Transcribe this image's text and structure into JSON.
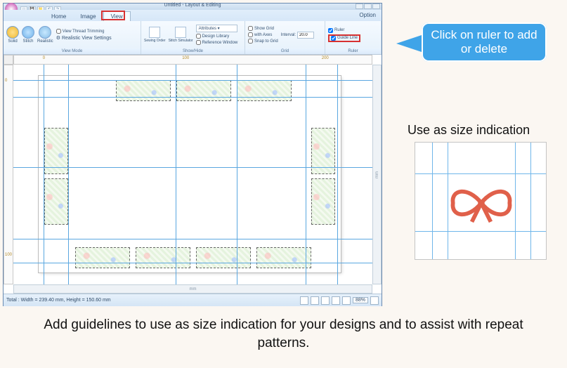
{
  "window": {
    "title": "Untitled - Layout & Editing",
    "option": "Option"
  },
  "tabs": {
    "home": "Home",
    "image": "Image",
    "view": "View"
  },
  "ribbon": {
    "view_mode": {
      "label": "View Mode",
      "solid": "Solid",
      "stitch": "Stitch",
      "realistic": "Realistic",
      "thread_trimming": "View Thread Trimming",
      "realistic_settings": "Realistic View Settings"
    },
    "show_hide": {
      "label": "Show/Hide",
      "sewing_order": "Sewing\nOrder",
      "stitch_simulator": "Stitch\nSimulator",
      "attributes": "Attributes",
      "design_library": "Design Library",
      "reference_window": "Reference Window"
    },
    "grid": {
      "label": "Grid",
      "show_grid": "Show Grid",
      "with_axes": "with Axes",
      "snap": "Snap to Grid",
      "interval_label": "Interval:",
      "interval_value": "20.0"
    },
    "ruler_group": {
      "label": "Ruler",
      "ruler": "Ruler",
      "guide_line": "Guide Line"
    }
  },
  "ruler": {
    "h0": "0",
    "h100": "100",
    "h200": "200",
    "v0": "0",
    "v100": "100",
    "unit": "mm"
  },
  "status": {
    "total": "Total :  Width = 239.40 mm, Height = 150.60 mm",
    "zoom": "88%"
  },
  "callout": {
    "text": "Click on ruler to add or delete"
  },
  "side": {
    "title": "Use as size indication"
  },
  "caption": {
    "text": "Add guidelines to use as size indication for your designs and to assist with repeat patterns."
  }
}
